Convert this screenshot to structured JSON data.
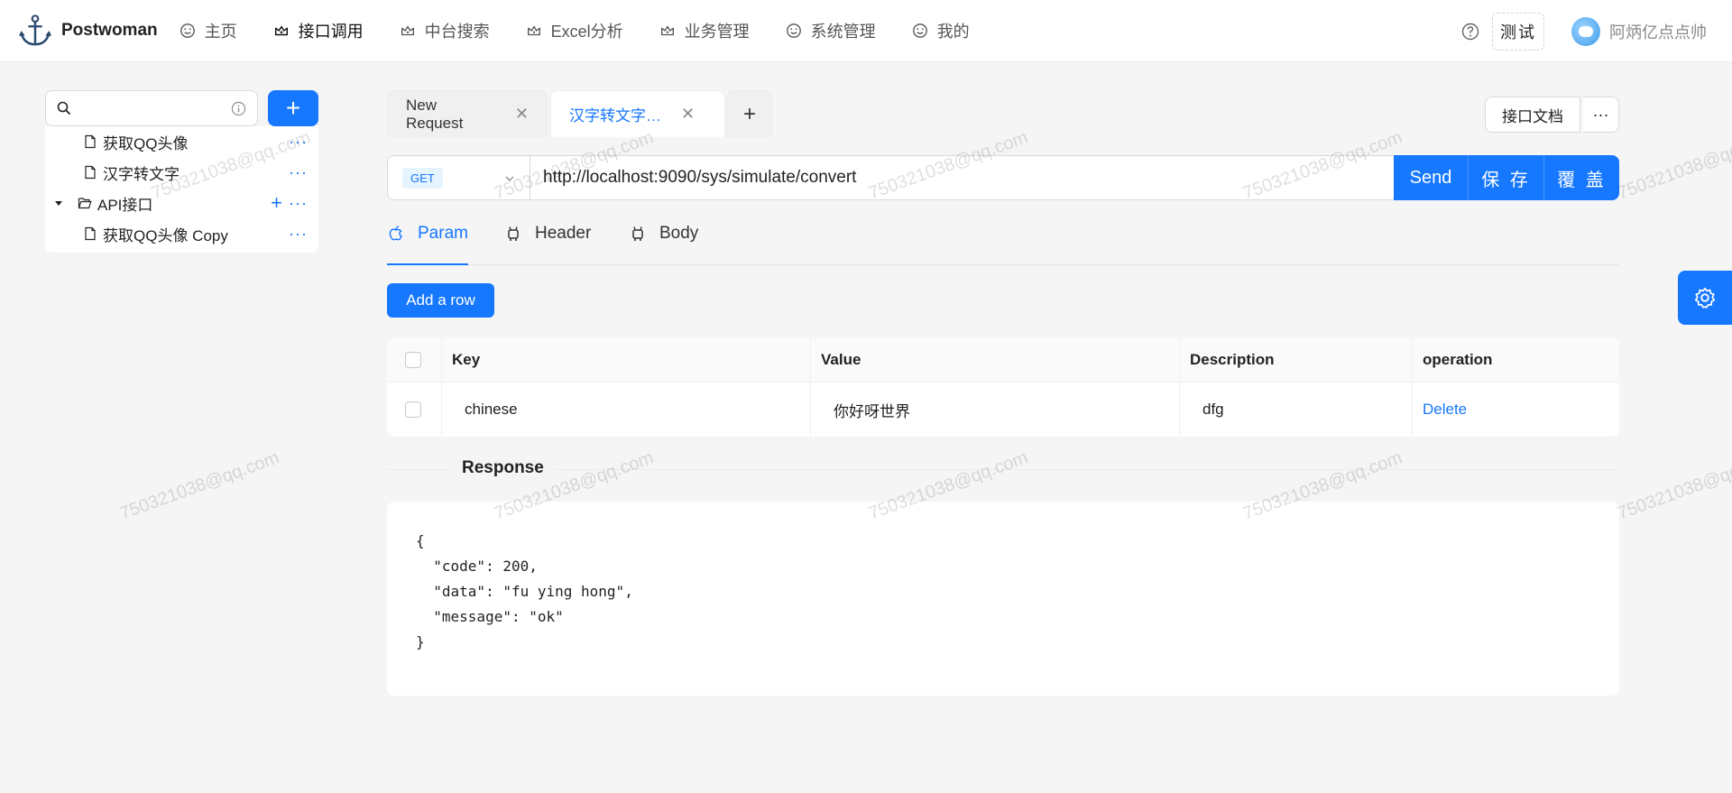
{
  "app": {
    "logo_text": "Postwoman"
  },
  "nav": {
    "items": [
      {
        "label": "主页",
        "icon": "smile-icon"
      },
      {
        "label": "接口调用",
        "icon": "crown-icon"
      },
      {
        "label": "中台搜索",
        "icon": "crown-icon"
      },
      {
        "label": "Excel分析",
        "icon": "crown-icon"
      },
      {
        "label": "业务管理",
        "icon": "crown-icon"
      },
      {
        "label": "系统管理",
        "icon": "smile-icon"
      },
      {
        "label": "我的",
        "icon": "smile-icon"
      }
    ],
    "active_index": 1
  },
  "header": {
    "env_label": "测试",
    "username": "阿炳亿点点帅"
  },
  "sidebar": {
    "search_placeholder": "",
    "add_label": "+",
    "tree": [
      {
        "label": "获取QQ头像",
        "type": "file"
      },
      {
        "label": "汉字转文字",
        "type": "file"
      },
      {
        "label": "API接口",
        "type": "folder"
      },
      {
        "label": "获取QQ头像 Copy",
        "type": "file"
      }
    ],
    "more_label": "···",
    "folder_add_label": "+"
  },
  "tabs": [
    {
      "label": "New Request",
      "active": false
    },
    {
      "label": "汉字转文字…",
      "active": true
    }
  ],
  "tab_add_label": "+",
  "tab_close_label": "✕",
  "doc_button_label": "接口文档",
  "doc_more_label": "···",
  "request": {
    "method": "GET",
    "url": "http://localhost:9090/sys/simulate/convert",
    "send_label": "Send",
    "save_label": "保 存",
    "overwrite_label": "覆 盖"
  },
  "subtabs": [
    {
      "label": "Param",
      "icon": "apple-icon"
    },
    {
      "label": "Header",
      "icon": "android-icon"
    },
    {
      "label": "Body",
      "icon": "android-icon"
    }
  ],
  "add_row_label": "Add a row",
  "params_table": {
    "columns": [
      "Key",
      "Value",
      "Description",
      "operation"
    ],
    "rows": [
      {
        "key": "chinese",
        "value": "你好呀世界",
        "description": "dfg",
        "operation": "Delete"
      }
    ]
  },
  "response": {
    "title": "Response",
    "body": "{\n  \"code\": 200,\n  \"data\": \"fu ying hong\",\n  \"message\": \"ok\"\n}"
  },
  "watermark": "750321038@qq.com",
  "colors": {
    "primary": "#1677ff",
    "background": "#f5f5f5"
  }
}
